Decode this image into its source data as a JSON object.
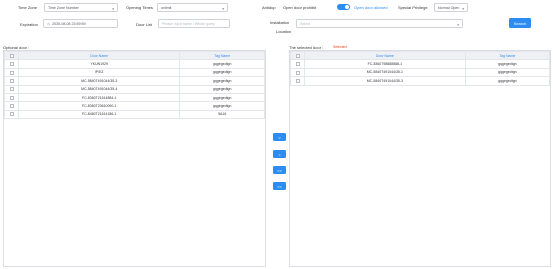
{
  "filters": {
    "time_zone_label": "Time Zone",
    "time_zone_value": "Time Zone Number",
    "opening_times_label": "Opening Times",
    "opening_times_value": "unlimit",
    "antidup_label": "Antidup",
    "open_door_prohibit": "Open door prohibit",
    "open_door_allowed": "Open door allowed",
    "special_privilege_label": "Special Privilege",
    "special_privilege_value": "Normal Open",
    "expiration_label": "Expiration",
    "expiration_value": "2030-08-08 23:59:59",
    "door_list_label": "Door List",
    "door_list_placeholder": "Please input name / Whole query",
    "installation_location_label_1": "Installation",
    "installation_location_label_2": "Location",
    "installation_placeholder": "Select",
    "search_label": "Search"
  },
  "optional": {
    "title": "Optional door :",
    "headers": [
      "Door Name",
      "Tag Name"
    ],
    "rows": [
      [
        "YKUN1929",
        "gqgegedtgn"
      ],
      [
        "IP/EZ",
        "gqgegedtgn"
      ],
      [
        "MC-5840T491044/35-3",
        "gqgegedtgn"
      ],
      [
        "MC-5840T491044/35-4",
        "gqgegedtgn"
      ],
      [
        "FC-8360T21614884-1",
        "gqgegedtgn"
      ],
      [
        "FC-8360T23610090-1",
        "gqgegedtgn"
      ],
      [
        "FC-8460T21614186-1",
        "5A16"
      ]
    ]
  },
  "selected": {
    "title": "The selected door :",
    "selected_badge": "Selected",
    "headers": [
      "Door Name",
      "Tag Name"
    ],
    "rows": [
      [
        "FC-8360T98888888-1",
        "gqgegedtgn"
      ],
      [
        "MC-5840T491044/35-1",
        "gqgegedtgn"
      ],
      [
        "MC-5840T491044/35-3",
        "gqgegedtgn"
      ]
    ]
  },
  "transfer_buttons": [
    ">",
    "<",
    ">>",
    "<<"
  ],
  "icons": {
    "calendar": "calendar-icon",
    "chevron": "chevron-down-icon"
  },
  "colors": {
    "primary": "#2d8cf0",
    "danger": "#ed3f14"
  }
}
